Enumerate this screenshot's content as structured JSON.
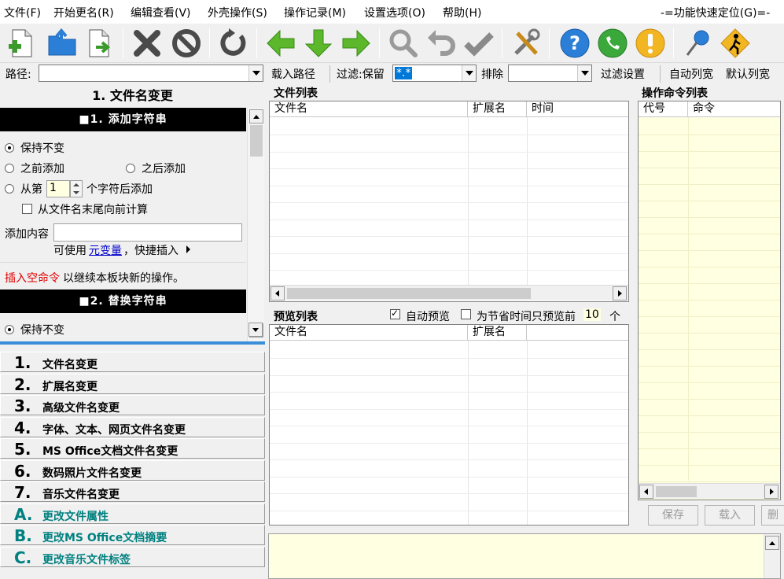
{
  "menu": {
    "file": "文件(F)",
    "rename": "开始更名(R)",
    "edit": "编辑查看(V)",
    "shell": "外壳操作(S)",
    "log": "操作记录(M)",
    "settings": "设置选项(O)",
    "help": "帮助(H)",
    "quick_locate": "-=功能快速定位(G)=-"
  },
  "pathbar": {
    "path_label": "路径:",
    "path_value": "",
    "load_path": "载入路径",
    "filter_label": "过滤:保留",
    "filter_value": "*.*",
    "exclude_label": "排除",
    "exclude_value": "",
    "filter_settings": "过滤设置",
    "auto_width": "自动列宽",
    "default_width": "默认列宽"
  },
  "left": {
    "section_title": "1. 文件名变更",
    "add_string_header": "■1. 添加字符串",
    "keep_unchanged": "保持不变",
    "add_before": "之前添加",
    "add_after": "之后添加",
    "from_pos_prefix": "从第",
    "from_pos_value": "1",
    "from_pos_suffix": "个字符后添加",
    "count_from_end": "从文件名末尾向前计算",
    "add_content_label": "添加内容",
    "add_content_value": "",
    "can_use": "可使用",
    "meta_var": "元变量",
    "quick_insert": "，快捷插入",
    "insert_empty_cmd": "插入空命令",
    "insert_empty_tail": " 以继续本板块新的操作。",
    "replace_header": "■2. 替换字符串",
    "replace_keep": "保持不变"
  },
  "categories": [
    {
      "num": "1.",
      "label": "文件名变更"
    },
    {
      "num": "2.",
      "label": "扩展名变更"
    },
    {
      "num": "3.",
      "label": "高级文件名变更"
    },
    {
      "num": "4.",
      "label": "字体、文本、网页文件名变更"
    },
    {
      "num": "5.",
      "label": "MS Office文档文件名变更"
    },
    {
      "num": "6.",
      "label": "数码照片文件名变更"
    },
    {
      "num": "7.",
      "label": "音乐文件名变更"
    },
    {
      "num": "A.",
      "label": "更改文件属性"
    },
    {
      "num": "B.",
      "label": "更改MS Office文档摘要"
    },
    {
      "num": "C.",
      "label": "更改音乐文件标签"
    }
  ],
  "file_list": {
    "title": "文件列表",
    "columns": [
      "文件名",
      "扩展名",
      "时间"
    ]
  },
  "preview_list": {
    "title": "预览列表",
    "auto_preview": "自动预览",
    "save_time_prefix": "为节省时间只预览前",
    "save_time_value": "10",
    "save_time_suffix": "个",
    "columns": [
      "文件名",
      "扩展名"
    ]
  },
  "command_list": {
    "title": "操作命令列表",
    "columns": [
      "代号",
      "命令"
    ],
    "save": "保存",
    "load": "载入",
    "more": "删"
  },
  "colors": {
    "accent_blue": "#0078d7",
    "teal": "#008080",
    "red_link": "#e00000",
    "cream": "#ffffe1"
  }
}
